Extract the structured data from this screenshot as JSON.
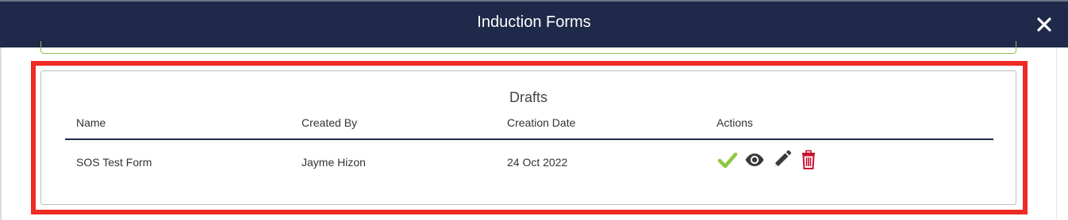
{
  "modal": {
    "title": "Induction Forms",
    "close_icon": "close-icon"
  },
  "drafts": {
    "title": "Drafts",
    "columns": [
      "Name",
      "Created By",
      "Creation Date",
      "Actions"
    ],
    "rows": [
      {
        "name": "SOS Test Form",
        "created_by": "Jayme Hizon",
        "creation_date": "24 Oct 2022",
        "actions": [
          "approve-check-icon",
          "view-eye-icon",
          "edit-pencil-icon",
          "delete-trash-icon"
        ]
      }
    ]
  },
  "colors": {
    "header_bg": "#1f2a4a",
    "highlight": "#ee2b24",
    "check": "#8dc63f",
    "icon_dark": "#3a3a3a",
    "trash": "#c8102e"
  }
}
